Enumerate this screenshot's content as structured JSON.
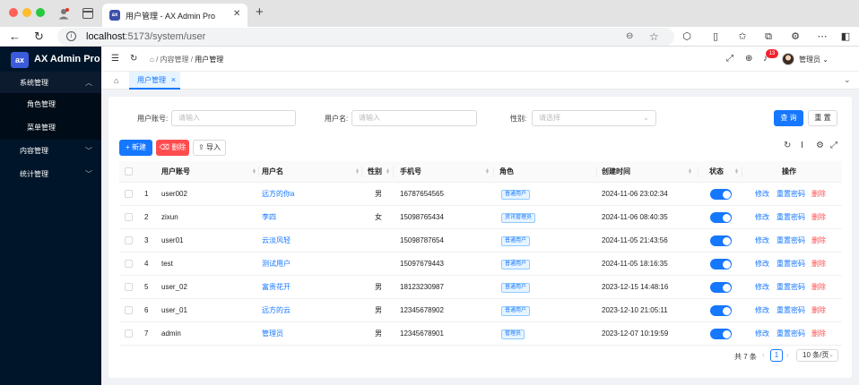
{
  "browser": {
    "tab_title": "用户管理 - AX Admin Pro",
    "tab_favicon": "ax",
    "url_host": "localhost",
    "url_path": ":5173/system/user"
  },
  "sidebar": {
    "logo_mark": "ax",
    "logo_text": "AX Admin Pro",
    "menus": [
      {
        "label": "系统管理",
        "expanded": true,
        "children": [
          "角色管理",
          "菜单管理"
        ]
      },
      {
        "label": "内容管理",
        "expanded": false
      },
      {
        "label": "统计管理",
        "expanded": false
      }
    ]
  },
  "header": {
    "breadcrumb": [
      "内容管理",
      "用户管理"
    ],
    "bell_count": "13",
    "user_name": "管理员"
  },
  "tags": {
    "active_tab": "用户管理"
  },
  "search": {
    "account_label": "用户账号:",
    "account_placeholder": "请输入",
    "name_label": "用户名:",
    "name_placeholder": "请输入",
    "gender_label": "性别:",
    "gender_placeholder": "请选择",
    "query_btn": "查 询",
    "reset_btn": "重 置"
  },
  "toolbar": {
    "add_btn": "新建",
    "delete_btn": "删除",
    "import_btn": "导入"
  },
  "table": {
    "columns": [
      "用户账号",
      "用户名",
      "性别",
      "手机号",
      "角色",
      "创建时间",
      "状态",
      "操作"
    ],
    "rows": [
      {
        "idx": "1",
        "account": "user002",
        "name": "远方的你a",
        "gender": "男",
        "phone": "16787654565",
        "role": "普通用户",
        "created": "2024-11-06 23:02:34",
        "enabled": true
      },
      {
        "idx": "2",
        "account": "zixun",
        "name": "李四",
        "gender": "女",
        "phone": "15098765434",
        "role": "资讯管理员",
        "created": "2024-11-06 08:40:35",
        "enabled": true
      },
      {
        "idx": "3",
        "account": "user01",
        "name": "云淡风轻",
        "gender": "",
        "phone": "15098787654",
        "role": "普通用户",
        "created": "2024-11-05 21:43:56",
        "enabled": true
      },
      {
        "idx": "4",
        "account": "test",
        "name": "测试用户",
        "gender": "",
        "phone": "15097679443",
        "role": "普通用户",
        "created": "2024-11-05 18:16:35",
        "enabled": true
      },
      {
        "idx": "5",
        "account": "user_02",
        "name": "富贵花开",
        "gender": "男",
        "phone": "18123230987",
        "role": "普通用户",
        "created": "2023-12-15 14:48:16",
        "enabled": true
      },
      {
        "idx": "6",
        "account": "user_01",
        "name": "远方的云",
        "gender": "男",
        "phone": "12345678902",
        "role": "普通用户",
        "created": "2023-12-10 21:05:11",
        "enabled": true
      },
      {
        "idx": "7",
        "account": "admin",
        "name": "管理员",
        "gender": "男",
        "phone": "12345678901",
        "role": "管理员",
        "created": "2023-12-07 10:19:59",
        "enabled": true
      }
    ],
    "actions": [
      "修改",
      "重置密码",
      "删除"
    ]
  },
  "pagination": {
    "total": "共 7 条",
    "current": "1",
    "page_size": "10 条/页"
  }
}
